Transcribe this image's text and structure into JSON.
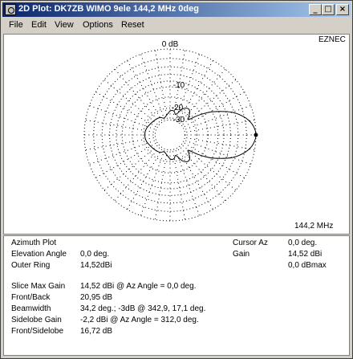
{
  "window": {
    "title": "2D Plot: DK7ZB WIMO 9ele 144,2 MHz 0deg"
  },
  "title_buttons": {
    "minimize": "_",
    "maximize": "□",
    "close": "×"
  },
  "menu": [
    {
      "label": "File"
    },
    {
      "label": "Edit"
    },
    {
      "label": "View"
    },
    {
      "label": "Options"
    },
    {
      "label": "Reset"
    }
  ],
  "plot": {
    "brand": "EZNEC",
    "frequency": "144,2 MHz",
    "ring_labels": {
      "r0": "0 dB",
      "r10": "-10",
      "r20": "-20",
      "r30": "-30"
    },
    "chart_data": {
      "type": "polar",
      "angle_unit": "deg",
      "radial_unit": "dB (relative to max)",
      "rings_db": [
        0,
        -10,
        -20,
        -30
      ],
      "pattern_peak_dbi": 14.52,
      "pattern": [
        {
          "az": 0,
          "db": 0
        },
        {
          "az": 5,
          "db": -0.3
        },
        {
          "az": 10,
          "db": -1.1
        },
        {
          "az": 15,
          "db": -2.5
        },
        {
          "az": 20,
          "db": -4.5
        },
        {
          "az": 25,
          "db": -7.5
        },
        {
          "az": 30,
          "db": -11
        },
        {
          "az": 35,
          "db": -16
        },
        {
          "az": 40,
          "db": -22
        },
        {
          "az": 45,
          "db": -20
        },
        {
          "az": 50,
          "db": -17.7
        },
        {
          "az": 55,
          "db": -17
        },
        {
          "az": 60,
          "db": -17.5
        },
        {
          "az": 65,
          "db": -19
        },
        {
          "az": 70,
          "db": -22
        },
        {
          "az": 75,
          "db": -24
        },
        {
          "az": 80,
          "db": -22
        },
        {
          "az": 85,
          "db": -21.5
        },
        {
          "az": 90,
          "db": -22
        },
        {
          "az": 100,
          "db": -25
        },
        {
          "az": 110,
          "db": -27
        },
        {
          "az": 120,
          "db": -25
        },
        {
          "az": 135,
          "db": -24
        },
        {
          "az": 150,
          "db": -23
        },
        {
          "az": 165,
          "db": -21.5
        },
        {
          "az": 180,
          "db": -21
        },
        {
          "az": 195,
          "db": -21.5
        },
        {
          "az": 210,
          "db": -23
        },
        {
          "az": 225,
          "db": -24
        },
        {
          "az": 240,
          "db": -25
        },
        {
          "az": 250,
          "db": -27
        },
        {
          "az": 260,
          "db": -25
        },
        {
          "az": 270,
          "db": -22
        },
        {
          "az": 275,
          "db": -21.5
        },
        {
          "az": 280,
          "db": -22
        },
        {
          "az": 285,
          "db": -24
        },
        {
          "az": 290,
          "db": -22
        },
        {
          "az": 295,
          "db": -19
        },
        {
          "az": 300,
          "db": -17.5
        },
        {
          "az": 305,
          "db": -17
        },
        {
          "az": 310,
          "db": -17.7
        },
        {
          "az": 315,
          "db": -20
        },
        {
          "az": 320,
          "db": -22
        },
        {
          "az": 325,
          "db": -16
        },
        {
          "az": 330,
          "db": -11
        },
        {
          "az": 335,
          "db": -7.5
        },
        {
          "az": 340,
          "db": -4.5
        },
        {
          "az": 345,
          "db": -2.5
        },
        {
          "az": 350,
          "db": -1.1
        },
        {
          "az": 355,
          "db": -0.3
        }
      ],
      "cursor_az_deg": 0
    }
  },
  "info": {
    "left": [
      {
        "label": "Azimuth Plot",
        "value": ""
      },
      {
        "label": "Elevation Angle",
        "value": "0,0 deg."
      },
      {
        "label": "Outer Ring",
        "value": "14,52dBi"
      }
    ],
    "right": [
      {
        "label": "Cursor Az",
        "value": "0,0 deg."
      },
      {
        "label": "Gain",
        "value": "14,52 dBi"
      },
      {
        "label": "",
        "value": "0,0 dBmax"
      }
    ],
    "bottom": [
      {
        "label": "Slice Max Gain",
        "value": "14,52 dBi @ Az Angle = 0,0 deg."
      },
      {
        "label": "Front/Back",
        "value": "20,95 dB"
      },
      {
        "label": "Beamwidth",
        "value": "34,2 deg.; -3dB @ 342,9, 17,1 deg."
      },
      {
        "label": "Sidelobe Gain",
        "value": "-2,2 dBi @ Az Angle = 312,0 deg."
      },
      {
        "label": "Front/Sidelobe",
        "value": "16,72 dB"
      }
    ]
  }
}
